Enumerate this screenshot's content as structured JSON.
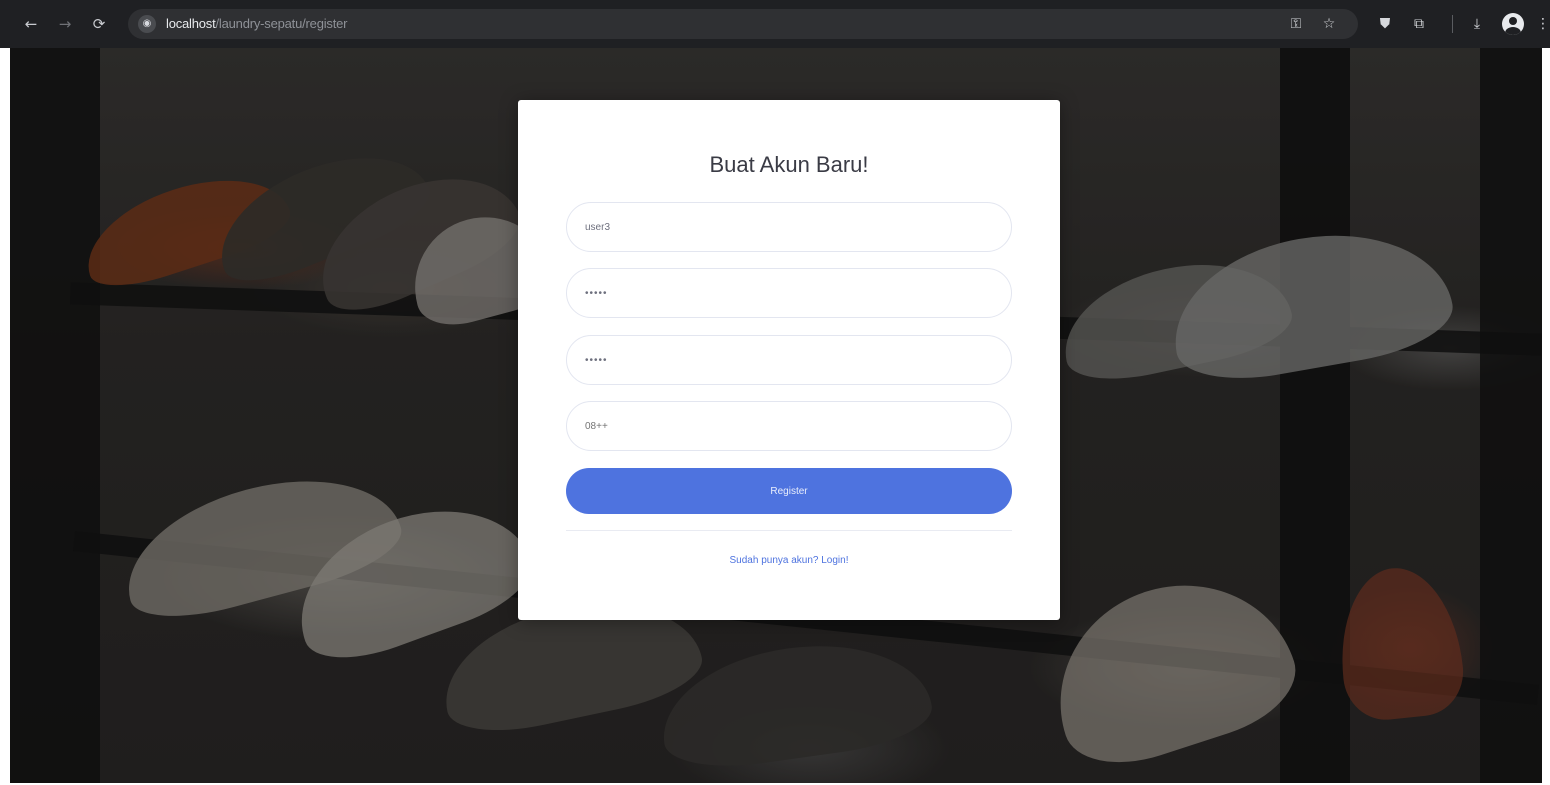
{
  "browser": {
    "url_host": "localhost",
    "url_path": "/laundry-sepatu/register"
  },
  "form": {
    "title": "Buat Akun Baru!",
    "username_value": "user3",
    "password_value": "•••••",
    "repeat_password_value": "•••••",
    "phone_placeholder": "08++",
    "register_label": "Register",
    "login_link": "Sudah punya akun? Login!"
  },
  "colors": {
    "accent": "#4e73df",
    "chrome_bg": "#1f2023"
  }
}
